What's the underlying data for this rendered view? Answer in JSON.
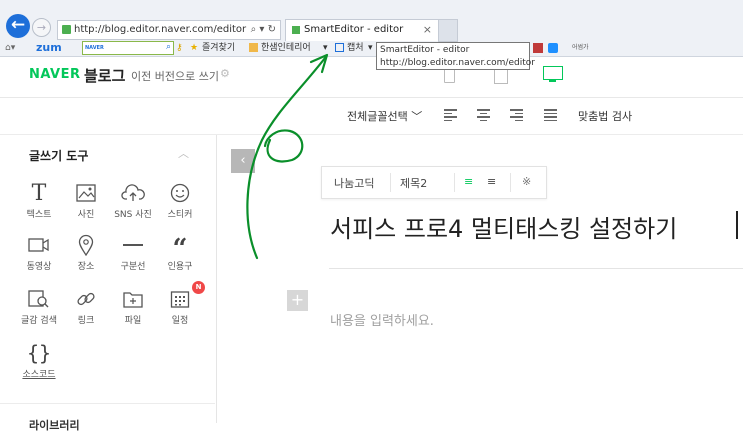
{
  "browser": {
    "back_glyph": "←",
    "forward_glyph": "→",
    "address_url": "http://blog.editor.naver.com/editor",
    "address_controls": "⌕ ▾ ↻",
    "tab_title": "SmartEditor - editor",
    "tab_close": "×",
    "favorites": {
      "zum_logo": "zum",
      "zum_search_brand": "NAVER",
      "bookmarks_label": "즐겨찾기",
      "hansaem_label": "한샘인테리어",
      "capture_label": "캡처",
      "extra_label": "어썸가"
    },
    "tooltip": {
      "title": "SmartEditor - editor",
      "url": "http://blog.editor.naver.com/editor"
    }
  },
  "header": {
    "naver_logo": "NAVER",
    "blog_label": "블로그",
    "prev_version": "이전 버전으로 쓰기"
  },
  "toolbar": {
    "font_select": "전체글꼴선택 ﹀",
    "spell_check": "맞춤법 검사"
  },
  "sidebar": {
    "title": "글쓰기 도구",
    "collapse_glyph": "︿",
    "tools": [
      {
        "label": "텍스트",
        "icon": "text-icon"
      },
      {
        "label": "사진",
        "icon": "photo-icon"
      },
      {
        "label": "SNS 사진",
        "icon": "sns-photo-icon"
      },
      {
        "label": "스티커",
        "icon": "sticker-icon"
      },
      {
        "label": "동영상",
        "icon": "video-icon"
      },
      {
        "label": "장소",
        "icon": "location-icon"
      },
      {
        "label": "구분선",
        "icon": "divider-icon"
      },
      {
        "label": "인용구",
        "icon": "quote-icon"
      },
      {
        "label": "글감 검색",
        "icon": "material-search-icon"
      },
      {
        "label": "링크",
        "icon": "link-icon"
      },
      {
        "label": "파일",
        "icon": "file-icon"
      },
      {
        "label": "일정",
        "icon": "schedule-icon"
      },
      {
        "label": "소스코드",
        "icon": "source-code-icon"
      }
    ],
    "schedule_badge": "N",
    "next_section": "라이브러리"
  },
  "editor": {
    "collapse_glyph": "‹",
    "float_toolbar": {
      "font": "나눔고딕",
      "heading": "제목2",
      "align_left": "≡",
      "align_center": "≡",
      "more": "※"
    },
    "title": "서피스 프로4 멀티태스킹 설정하기",
    "add_glyph": "+",
    "body_placeholder": "내용을 입력하세요."
  },
  "colors": {
    "naver_green": "#03c75a",
    "annotation_green": "#0a8f2a",
    "browser_blue": "#1e6fd9",
    "badge_red": "#f04848"
  }
}
